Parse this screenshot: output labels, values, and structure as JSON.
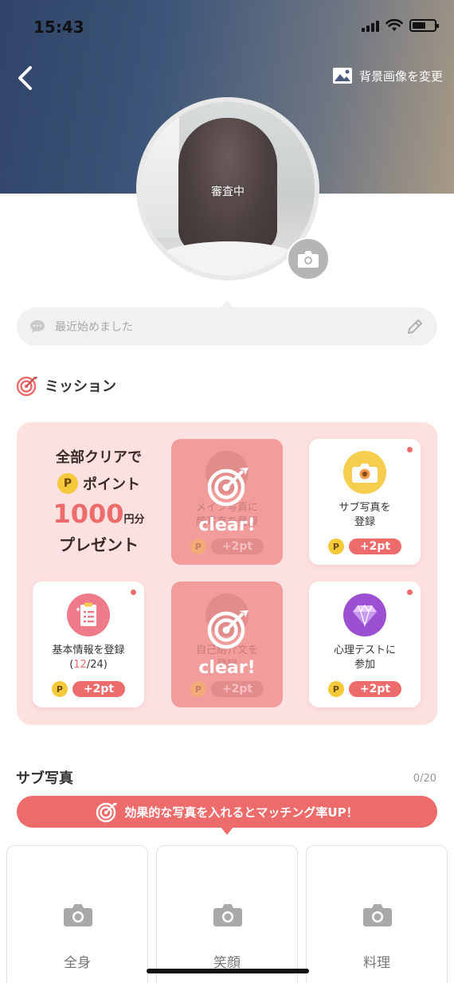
{
  "status_bar": {
    "time": "15:43"
  },
  "header": {
    "bg_change_label": "背景画像を変更"
  },
  "profile": {
    "review_status": "審査中",
    "comment_placeholder": "最近始めました"
  },
  "mission": {
    "title": "ミッション",
    "all_clear": {
      "line1": "全部クリアで",
      "point_badge": "P",
      "line2": "ポイント",
      "amount": "1000",
      "amount_unit": "円分",
      "line4": "プレゼント"
    },
    "cards": [
      {
        "label_line1": "メイン写真に",
        "label_line2": "顔写真を登録",
        "points": "+2pt",
        "cleared": true,
        "clear_text": "clear!"
      },
      {
        "label_line1": "サブ写真を",
        "label_line2": "登録",
        "points": "+2pt",
        "cleared": false
      },
      {
        "label_line1": "基本情報を登録",
        "progress_open": "(",
        "progress_done": "12",
        "progress_rest": "/24)",
        "points": "+2pt",
        "cleared": false
      },
      {
        "label_line1": "自己紹介文を",
        "label_line2": "登録",
        "points": "+2pt",
        "cleared": true,
        "clear_text": "clear!"
      },
      {
        "label_line1": "心理テストに",
        "label_line2": "参加",
        "points": "+2pt",
        "cleared": false
      }
    ],
    "point_badge": "P"
  },
  "sub_photos": {
    "title": "サブ写真",
    "count": "0/20",
    "banner": "効果的な写真を入れるとマッチング率UP！",
    "slots": [
      "全身",
      "笑顔",
      "料理"
    ]
  },
  "colors": {
    "accent": "#ee6b6b",
    "panel": "#fce1e1",
    "point": "#f4c93a",
    "cleared": "#f29c9c"
  }
}
